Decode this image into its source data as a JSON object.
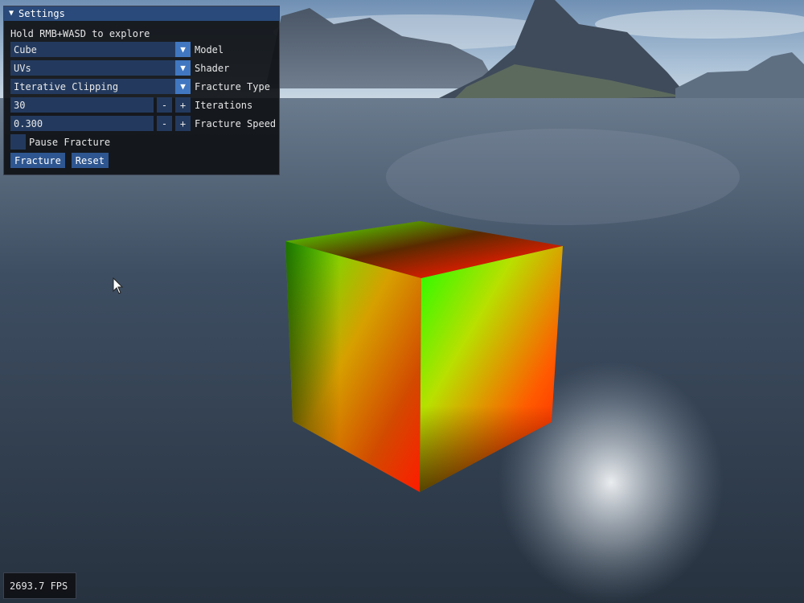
{
  "settings": {
    "title": "Settings",
    "hint": "Hold RMB+WASD to explore",
    "model": {
      "value": "Cube",
      "label": "Model"
    },
    "shader": {
      "value": "UVs",
      "label": "Shader"
    },
    "fracture_type": {
      "value": "Iterative Clipping",
      "label": "Fracture Type"
    },
    "iterations": {
      "value": "30",
      "label": "Iterations"
    },
    "fracture_speed": {
      "value": "0.300",
      "label": "Fracture Speed"
    },
    "pause_fracture": {
      "label": "Pause Fracture",
      "checked": false
    },
    "buttons": {
      "fracture": "Fracture",
      "reset": "Reset"
    },
    "stepper": {
      "minus": "-",
      "plus": "+"
    }
  },
  "fps_overlay": {
    "text": "2693.7 FPS"
  },
  "colors": {
    "title_bar": "#294a7a",
    "frame_bg": "#233a5e",
    "button": "#2e5690",
    "accent": "#4177c0"
  }
}
